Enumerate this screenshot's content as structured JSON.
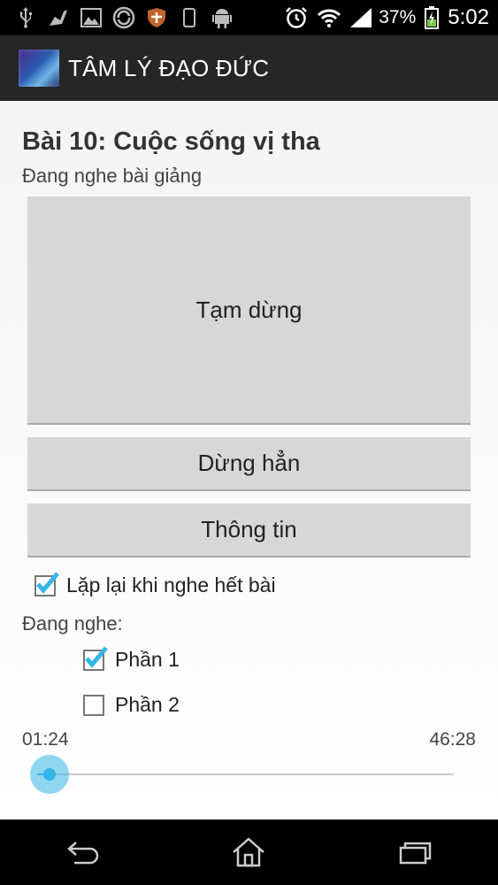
{
  "status_bar": {
    "battery_percent": "37%",
    "time": "5:02",
    "left_icons": [
      "usb-icon",
      "cleaner-icon",
      "gallery-icon",
      "sync-icon",
      "shield-icon",
      "phone-icon",
      "android-icon"
    ],
    "right_icons": [
      "alarm-icon",
      "wifi-icon",
      "signal-icon",
      "battery-charging-icon"
    ]
  },
  "action_bar": {
    "title": "TÂM LÝ ĐẠO ĐỨC"
  },
  "lesson": {
    "title": "Bài 10: Cuộc sống vị tha",
    "status": "Đang nghe bài giảng"
  },
  "buttons": {
    "pause": "Tạm dừng",
    "stop": "Dừng hẳn",
    "info": "Thông tin"
  },
  "repeat": {
    "label": "Lặp lại khi nghe hết bài",
    "checked": true
  },
  "listening": {
    "label": "Đang nghe:",
    "parts": [
      {
        "label": "Phần 1",
        "checked": true
      },
      {
        "label": "Phần 2",
        "checked": false
      }
    ]
  },
  "player": {
    "current_time": "01:24",
    "total_time": "46:28",
    "progress_fraction": 0.03
  },
  "colors": {
    "accent": "#33b5e5",
    "action_bar": "#262626"
  }
}
